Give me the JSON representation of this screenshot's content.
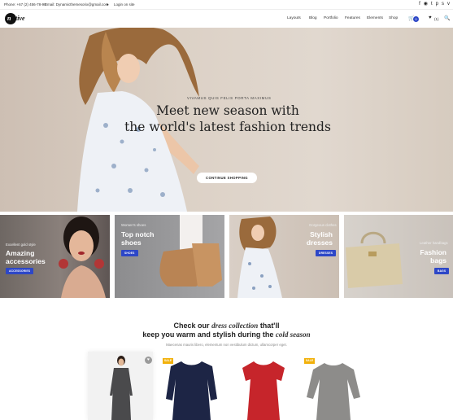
{
  "topbar": {
    "phone": "Phone: +67 (2) 456-78-90",
    "email": "Email: Dynamicthemesorix@gmail.com",
    "login": "Login on site",
    "social": [
      "facebook-icon",
      "instagram-icon",
      "twitter-icon",
      "pinterest-icon",
      "skype-icon",
      "vine-icon"
    ]
  },
  "header": {
    "logo": "native",
    "nav": [
      "Layouts",
      "Blog",
      "Portfolio",
      "Features",
      "Elements",
      "Shop"
    ],
    "cart_count": "0",
    "wishlist_count": "(1)"
  },
  "hero": {
    "subtitle": "VIVAMUS QUIS FELIS PORTA MAXIMUS",
    "title_line1": "Meet new season with",
    "title_line2": "the world's latest fashion trends",
    "button": "CONTINUE SHOPPING"
  },
  "tiles": [
    {
      "small": "Excellent gold style",
      "big1": "Amazing",
      "big2": "accessories",
      "button": "ACCESSORIES"
    },
    {
      "small": "Women's shoes",
      "big1": "Top notch",
      "big2": "shoes",
      "button": "SHOES"
    },
    {
      "small": "Gorgeous clothes",
      "big1": "Stylish",
      "big2": "dresses",
      "button": "DRESSES"
    },
    {
      "small": "Leather handbags",
      "big1": "Fashion",
      "big2": "bags",
      "button": "BAGS"
    }
  ],
  "collection": {
    "title_pre": "Check our ",
    "title_em1": "dress collection",
    "title_mid": " that'll",
    "title_line2_pre": "keep you warm and stylish during the ",
    "title_em2": "cold season",
    "subtitle": "Maecenas mauris libero, elementum non vestibulum dictum, ullamcorper eget.",
    "sale_label": "SALE"
  },
  "colors": {
    "accent": "#2d47c7",
    "sale": "#f2b10b"
  }
}
